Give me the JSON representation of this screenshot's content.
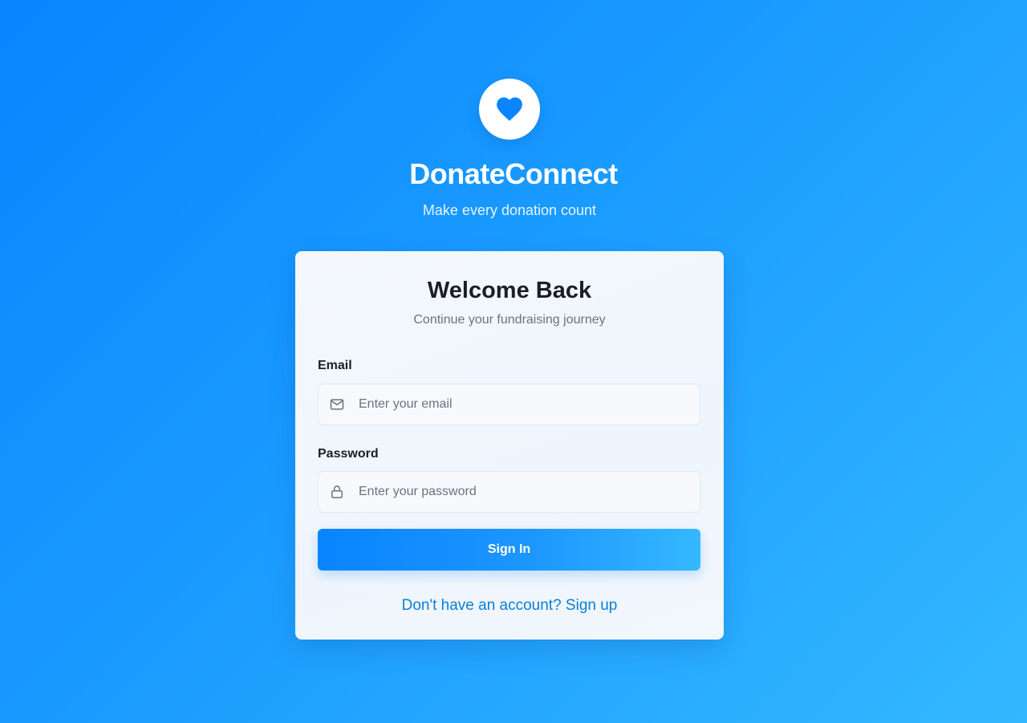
{
  "brand": {
    "name": "DonateConnect",
    "tagline": "Make every donation count",
    "logo_icon": "heart-icon",
    "accent_color": "#0a84ff"
  },
  "login_card": {
    "title": "Welcome Back",
    "subtitle": "Continue your fundraising journey",
    "email": {
      "label": "Email",
      "placeholder": "Enter your email",
      "value": "",
      "icon": "mail-icon"
    },
    "password": {
      "label": "Password",
      "placeholder": "Enter your password",
      "value": "",
      "icon": "lock-icon"
    },
    "submit_label": "Sign In",
    "signup_link_text": "Don't have an account? Sign up"
  }
}
